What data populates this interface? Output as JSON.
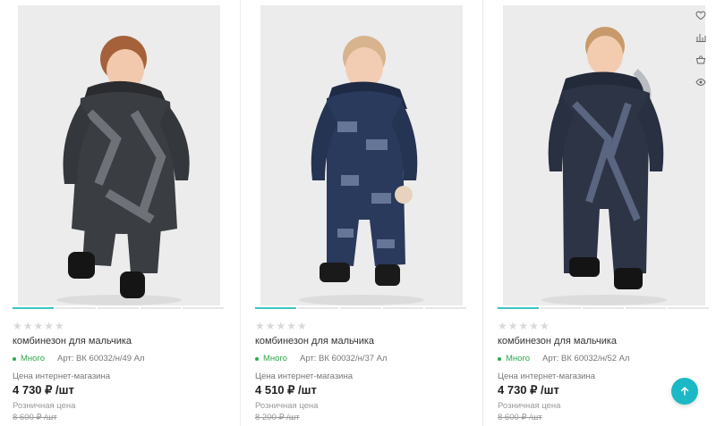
{
  "accent_color": "#3bc6c4",
  "stock_color": "#2fa84f",
  "scroll_top_color": "#1bb9c6",
  "side_tools": [
    {
      "icon": "heart-icon"
    },
    {
      "icon": "compare-icon"
    },
    {
      "icon": "basket-icon"
    },
    {
      "icon": "eye-icon"
    }
  ],
  "scroll_top": {
    "icon": "arrow-up-icon"
  },
  "products": [
    {
      "image": "grey-black patterned hooded snowsuit",
      "rating_stars": "★★★★★",
      "title": "комбинезон для мальчика",
      "stock": "Много",
      "article": "Арт: ВК 60032/н/49 Ал",
      "price_label": "Цена интернет-магазина",
      "price": "4 730 ₽ /шт",
      "retail_label": "Розничная цена",
      "old_price": "8 600 ₽ /шт"
    },
    {
      "image": "navy blue printed hooded snowsuit",
      "rating_stars": "★★★★★",
      "title": "комбинезон для мальчика",
      "stock": "Много",
      "article": "Арт: ВК 60032/н/37 Ал",
      "price_label": "Цена интернет-магазина",
      "price": "4 510 ₽ /шт",
      "retail_label": "Розничная цена",
      "old_price": "8 200 ₽ /шт"
    },
    {
      "image": "dark navy geometric hooded snowsuit",
      "rating_stars": "★★★★★",
      "title": "комбинезон для мальчика",
      "stock": "Много",
      "article": "Арт: ВК 60032/н/52 Ал",
      "price_label": "Цена интернет-магазина",
      "price": "4 730 ₽ /шт",
      "retail_label": "Розничная цена",
      "old_price": "8 600 ₽ /шт"
    }
  ]
}
